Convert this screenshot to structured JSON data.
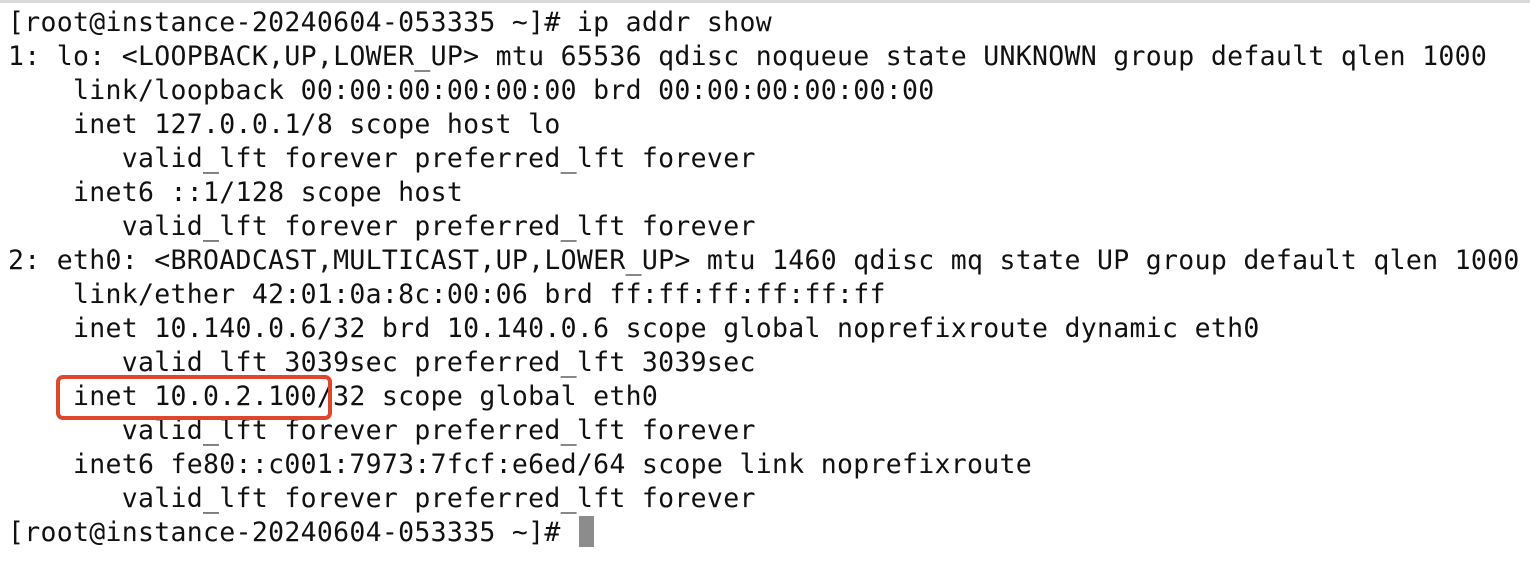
{
  "terminal": {
    "lines": [
      "[root@instance-20240604-053335 ~]# ip addr show",
      "1: lo: <LOOPBACK,UP,LOWER_UP> mtu 65536 qdisc noqueue state UNKNOWN group default qlen 1000",
      "    link/loopback 00:00:00:00:00:00 brd 00:00:00:00:00:00",
      "    inet 127.0.0.1/8 scope host lo",
      "       valid_lft forever preferred_lft forever",
      "    inet6 ::1/128 scope host",
      "       valid_lft forever preferred_lft forever",
      "2: eth0: <BROADCAST,MULTICAST,UP,LOWER_UP> mtu 1460 qdisc mq state UP group default qlen 1000",
      "    link/ether 42:01:0a:8c:00:06 brd ff:ff:ff:ff:ff:ff",
      "    inet 10.140.0.6/32 brd 10.140.0.6 scope global noprefixroute dynamic eth0",
      "       valid_lft 3039sec preferred_lft 3039sec",
      "    inet 10.0.2.100/32 scope global eth0",
      "       valid_lft forever preferred_lft forever",
      "    inet6 fe80::c001:7973:7fcf:e6ed/64 scope link noprefixroute",
      "       valid_lft forever preferred_lft forever"
    ],
    "prompt": "[root@instance-20240604-053335 ~]# "
  },
  "colors": {
    "text": "#111111",
    "background": "#ffffff",
    "highlight": "#e0452e",
    "cursor": "#8c8c8c"
  }
}
